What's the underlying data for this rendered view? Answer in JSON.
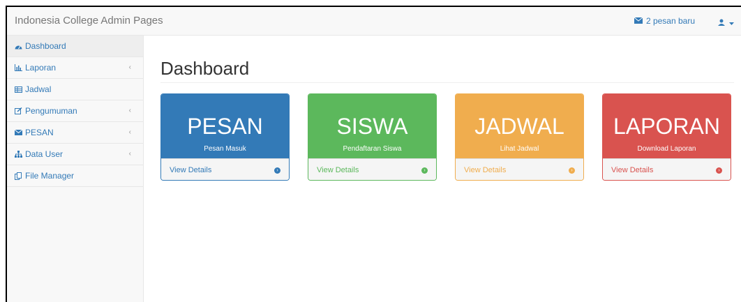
{
  "topbar": {
    "brand": "Indonesia College Admin Pages",
    "messages_label": "2 pesan baru"
  },
  "sidebar": {
    "items": [
      {
        "label": "Dashboard",
        "icon": "dashboard-icon",
        "active": true,
        "has_arrow": false
      },
      {
        "label": "Laporan",
        "icon": "bar-chart-icon",
        "active": false,
        "has_arrow": true
      },
      {
        "label": "Jadwal",
        "icon": "table-icon",
        "active": false,
        "has_arrow": false
      },
      {
        "label": "Pengumuman",
        "icon": "edit-icon",
        "active": false,
        "has_arrow": true
      },
      {
        "label": "PESAN",
        "icon": "envelope-icon",
        "active": false,
        "has_arrow": true
      },
      {
        "label": "Data User",
        "icon": "sitemap-icon",
        "active": false,
        "has_arrow": true
      },
      {
        "label": "File Manager",
        "icon": "files-icon",
        "active": false,
        "has_arrow": false
      }
    ]
  },
  "main": {
    "title": "Dashboard",
    "panels": [
      {
        "title": "PESAN",
        "subtitle": "Pesan Masuk",
        "footer": "View Details",
        "color": "#337ab7"
      },
      {
        "title": "SISWA",
        "subtitle": "Pendaftaran Siswa",
        "footer": "View Details",
        "color": "#5cb85c"
      },
      {
        "title": "JADWAL",
        "subtitle": "Lihat Jadwal",
        "footer": "View Details",
        "color": "#f0ad4e"
      },
      {
        "title": "LAPORAN",
        "subtitle": "Download Laporan",
        "footer": "View Details",
        "color": "#d9534f"
      }
    ]
  }
}
